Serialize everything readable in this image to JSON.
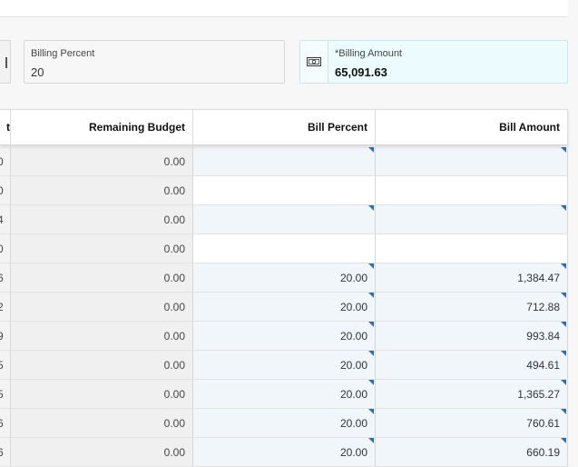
{
  "billing_percent": {
    "label": "Billing Percent",
    "value": "20"
  },
  "billing_amount": {
    "label": "*Billing Amount",
    "value": "65,091.63",
    "icon": "money-icon"
  },
  "table": {
    "columns": [
      "t",
      "Remaining Budget",
      "Bill Percent",
      "Bill Amount"
    ],
    "rows": [
      {
        "cut": "0",
        "remaining": "0.00",
        "bill_percent": "",
        "bill_amount": "",
        "shaded": true,
        "flag": true
      },
      {
        "cut": "0",
        "remaining": "0.00",
        "bill_percent": "",
        "bill_amount": "",
        "shaded": false,
        "flag": false
      },
      {
        "cut": "4",
        "remaining": "0.00",
        "bill_percent": "",
        "bill_amount": "",
        "shaded": true,
        "flag": true
      },
      {
        "cut": "0",
        "remaining": "0.00",
        "bill_percent": "",
        "bill_amount": "",
        "shaded": false,
        "flag": false
      },
      {
        "cut": "6",
        "remaining": "0.00",
        "bill_percent": "20.00",
        "bill_amount": "1,384.47",
        "shaded": true,
        "flag": true
      },
      {
        "cut": "2",
        "remaining": "0.00",
        "bill_percent": "20.00",
        "bill_amount": "712.88",
        "shaded": true,
        "flag": true
      },
      {
        "cut": "9",
        "remaining": "0.00",
        "bill_percent": "20.00",
        "bill_amount": "993.84",
        "shaded": true,
        "flag": true
      },
      {
        "cut": "5",
        "remaining": "0.00",
        "bill_percent": "20.00",
        "bill_amount": "494.61",
        "shaded": true,
        "flag": true
      },
      {
        "cut": "5",
        "remaining": "0.00",
        "bill_percent": "20.00",
        "bill_amount": "1,365.27",
        "shaded": true,
        "flag": true
      },
      {
        "cut": "6",
        "remaining": "0.00",
        "bill_percent": "20.00",
        "bill_amount": "760.61",
        "shaded": true,
        "flag": true
      },
      {
        "cut": "6",
        "remaining": "0.00",
        "bill_percent": "20.00",
        "bill_amount": "660.19",
        "shaded": true,
        "flag": true
      }
    ]
  },
  "colors": {
    "editable_cell": "#f1f6fb",
    "flag": "#2a6fb6",
    "amount_field": "#ecfbfd"
  }
}
